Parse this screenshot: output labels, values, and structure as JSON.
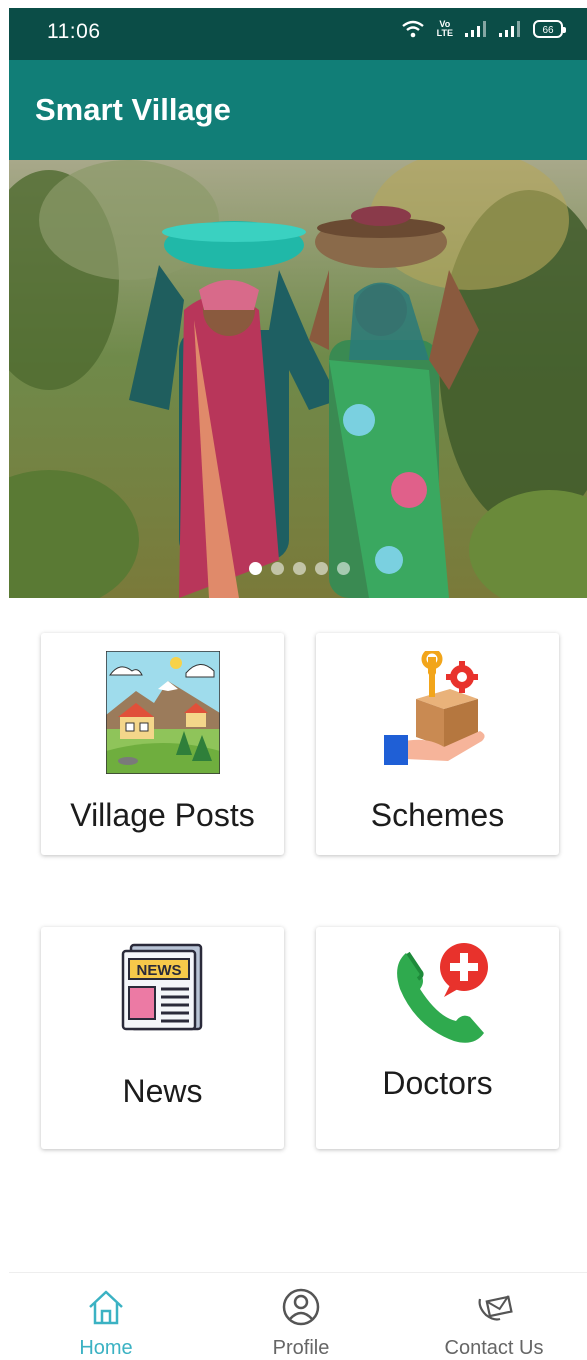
{
  "status_bar": {
    "time": "11:06",
    "volte_top": "Vo",
    "volte_bottom": "LTE",
    "battery": "66"
  },
  "app_bar": {
    "title": "Smart Village"
  },
  "carousel": {
    "slide_count": 5,
    "active_index": 0
  },
  "cards": [
    {
      "label": "Village Posts",
      "icon": "village-landscape-icon"
    },
    {
      "label": "Schemes",
      "icon": "hand-box-tools-icon"
    },
    {
      "label": "News",
      "icon": "newspaper-icon",
      "icon_text": "NEWS"
    },
    {
      "label": "Doctors",
      "icon": "phone-medical-icon"
    }
  ],
  "bottom_nav": [
    {
      "label": "Home",
      "icon": "home-icon",
      "active": true
    },
    {
      "label": "Profile",
      "icon": "profile-icon",
      "active": false
    },
    {
      "label": "Contact Us",
      "icon": "contact-mail-icon",
      "active": false
    }
  ],
  "colors": {
    "status_bar": "#0b4d47",
    "app_bar": "#117e77",
    "nav_active": "#3bb2c3",
    "nav_inactive": "#666666"
  }
}
